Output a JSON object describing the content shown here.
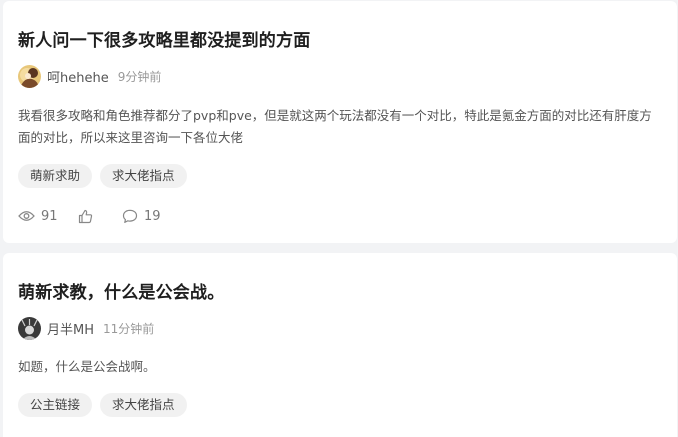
{
  "posts": [
    {
      "title": "新人问一下很多攻略里都没提到的方面",
      "author": "呵hehehe",
      "time": "9分钟前",
      "excerpt": "我看很多攻略和角色推荐都分了pvp和pve，但是就这两个玩法都没有一个对比，特此是氪金方面的对比还有肝度方面的对比，所以来这里咨询一下各位大佬",
      "tags": [
        "萌新求助",
        "求大佬指点"
      ],
      "views": "91",
      "comments": "19"
    },
    {
      "title": "萌新求教，什么是公会战。",
      "author": "月半MH",
      "time": "11分钟前",
      "excerpt": "如题，什么是公会战啊。",
      "tags": [
        "公主链接",
        "求大佬指点"
      ]
    }
  ],
  "icons": {
    "views": "eye-icon",
    "likes": "thumbs-up-icon",
    "comments": "comment-bubble-icon"
  }
}
